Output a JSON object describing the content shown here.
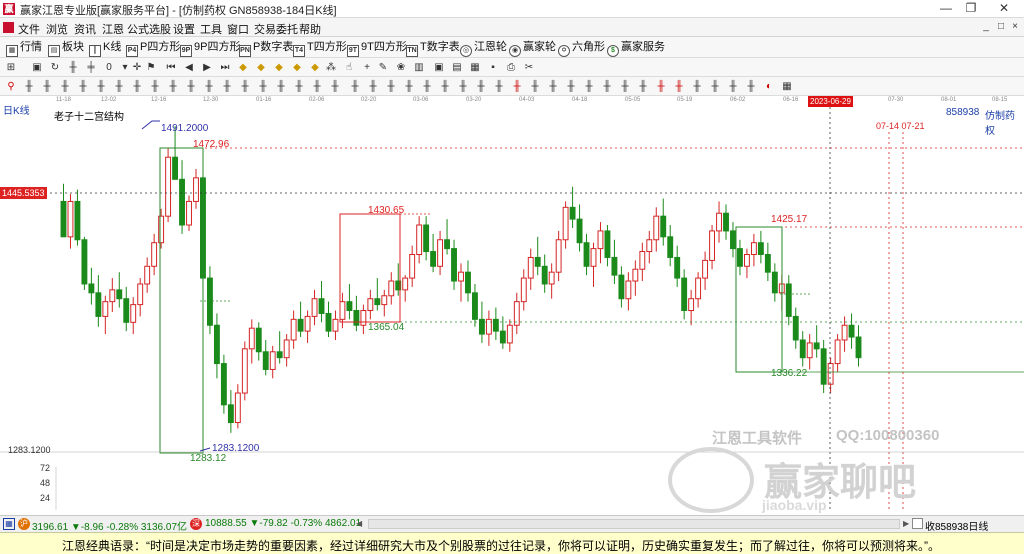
{
  "window": {
    "title": "赢家江恩专业版[赢家服务平台] - [仿制药权  GN858938-184日K线]",
    "minimize": "—",
    "restore": "❐",
    "close": "✕"
  },
  "menu": {
    "items": [
      "文件",
      "浏览",
      "资讯",
      "江恩",
      "公式选股",
      "设置",
      "工具",
      "窗口",
      "交易委托",
      "帮助"
    ],
    "mdi_min": "_",
    "mdi_restore": "□",
    "mdi_close": "×"
  },
  "toolbar1": {
    "items": [
      {
        "label": "行情",
        "icon": "grid-icon"
      },
      {
        "label": "板块",
        "icon": "sector-icon"
      },
      {
        "label": "K线",
        "icon": "kline-icon"
      },
      {
        "label": "P四方形",
        "icon": "p-square-icon",
        "glyph": "P4"
      },
      {
        "label": "9P四方形",
        "icon": "9p-square-icon",
        "glyph": "9P"
      },
      {
        "label": "P数字表",
        "icon": "p-number-table-icon",
        "glyph": "PN"
      },
      {
        "label": "T四方形",
        "icon": "t-square-icon",
        "glyph": "T4"
      },
      {
        "label": "9T四方形",
        "icon": "9t-square-icon",
        "glyph": "9T"
      },
      {
        "label": "T数字表",
        "icon": "t-number-table-icon",
        "glyph": "TN"
      },
      {
        "label": "江恩轮",
        "icon": "gann-wheel-icon"
      },
      {
        "label": "赢家轮",
        "icon": "winner-wheel-icon"
      },
      {
        "label": "六角形",
        "icon": "hexagon-icon"
      },
      {
        "label": "赢家服务",
        "icon": "service-icon"
      }
    ]
  },
  "chart_header": {
    "period_label": "日K线",
    "indicator_label": "老子十二宫结构",
    "code": "858938",
    "name": "仿制药权"
  },
  "date_axis": {
    "ticks": [
      "11-18",
      "12-02",
      "12-16",
      "12-30",
      "01-16",
      "02-06",
      "02-20",
      "03-06",
      "03-20",
      "04-03",
      "04-18",
      "05-05",
      "05-19",
      "06-02",
      "06-16",
      "07-14",
      "07-30",
      "08-01",
      "08-15"
    ],
    "current": "2023-06-29"
  },
  "price_axis": {
    "current_price": "1445.5353",
    "low_label": "1283.1200",
    "volume_ticks": [
      "72",
      "48",
      "24"
    ]
  },
  "annotations": {
    "high": "1491.2000",
    "box1_top": "1472.96",
    "box1_bottom": "1283.12",
    "low": "1283.1200",
    "box2_top": "1430.65",
    "box2_bottom": "1365.04",
    "box3_top": "1425.17",
    "box3_bottom": "1336.22",
    "future_dates": "07-14 07-21"
  },
  "chart_data": {
    "type": "candlestick",
    "title": "老子十二宫结构",
    "ylim": [
      1270,
      1500
    ],
    "up_color": "#d42424",
    "down_color": "#1a8a1a",
    "candles": [
      [
        1440,
        1452,
        1420,
        1416
      ],
      [
        1416,
        1445,
        1408,
        1440
      ],
      [
        1440,
        1448,
        1410,
        1414
      ],
      [
        1414,
        1416,
        1380,
        1384
      ],
      [
        1384,
        1395,
        1370,
        1378
      ],
      [
        1378,
        1390,
        1355,
        1362
      ],
      [
        1362,
        1376,
        1350,
        1372
      ],
      [
        1372,
        1388,
        1365,
        1380
      ],
      [
        1380,
        1392,
        1368,
        1374
      ],
      [
        1374,
        1382,
        1352,
        1358
      ],
      [
        1358,
        1375,
        1350,
        1370
      ],
      [
        1370,
        1388,
        1362,
        1384
      ],
      [
        1384,
        1402,
        1378,
        1396
      ],
      [
        1396,
        1418,
        1390,
        1412
      ],
      [
        1412,
        1435,
        1408,
        1430
      ],
      [
        1430,
        1476,
        1426,
        1470
      ],
      [
        1470,
        1491,
        1462,
        1455
      ],
      [
        1455,
        1468,
        1418,
        1424
      ],
      [
        1424,
        1444,
        1420,
        1440
      ],
      [
        1440,
        1462,
        1435,
        1456
      ],
      [
        1456,
        1460,
        1380,
        1388
      ],
      [
        1388,
        1396,
        1350,
        1356
      ],
      [
        1356,
        1364,
        1320,
        1330
      ],
      [
        1330,
        1336,
        1296,
        1302
      ],
      [
        1302,
        1312,
        1283,
        1290
      ],
      [
        1290,
        1316,
        1286,
        1310
      ],
      [
        1310,
        1345,
        1305,
        1340
      ],
      [
        1340,
        1360,
        1330,
        1354
      ],
      [
        1354,
        1358,
        1332,
        1338
      ],
      [
        1338,
        1346,
        1322,
        1326
      ],
      [
        1326,
        1342,
        1320,
        1338
      ],
      [
        1338,
        1352,
        1330,
        1334
      ],
      [
        1334,
        1350,
        1328,
        1346
      ],
      [
        1346,
        1366,
        1340,
        1360
      ],
      [
        1360,
        1372,
        1348,
        1352
      ],
      [
        1352,
        1366,
        1344,
        1362
      ],
      [
        1362,
        1380,
        1356,
        1374
      ],
      [
        1374,
        1386,
        1358,
        1364
      ],
      [
        1364,
        1372,
        1348,
        1352
      ],
      [
        1352,
        1366,
        1346,
        1360
      ],
      [
        1360,
        1378,
        1354,
        1372
      ],
      [
        1372,
        1384,
        1360,
        1366
      ],
      [
        1366,
        1376,
        1352,
        1356
      ],
      [
        1356,
        1370,
        1350,
        1366
      ],
      [
        1366,
        1380,
        1360,
        1374
      ],
      [
        1374,
        1388,
        1366,
        1370
      ],
      [
        1370,
        1380,
        1362,
        1376
      ],
      [
        1376,
        1392,
        1370,
        1386
      ],
      [
        1386,
        1398,
        1376,
        1380
      ],
      [
        1380,
        1390,
        1372,
        1388
      ],
      [
        1388,
        1410,
        1382,
        1404
      ],
      [
        1404,
        1430,
        1398,
        1424
      ],
      [
        1424,
        1430,
        1400,
        1406
      ],
      [
        1406,
        1418,
        1392,
        1396
      ],
      [
        1396,
        1420,
        1390,
        1414
      ],
      [
        1414,
        1428,
        1404,
        1408
      ],
      [
        1408,
        1414,
        1380,
        1386
      ],
      [
        1386,
        1398,
        1372,
        1392
      ],
      [
        1392,
        1400,
        1372,
        1378
      ],
      [
        1378,
        1384,
        1355,
        1360
      ],
      [
        1360,
        1372,
        1344,
        1350
      ],
      [
        1350,
        1366,
        1342,
        1360
      ],
      [
        1360,
        1368,
        1346,
        1352
      ],
      [
        1352,
        1362,
        1340,
        1344
      ],
      [
        1344,
        1360,
        1338,
        1356
      ],
      [
        1356,
        1378,
        1350,
        1372
      ],
      [
        1372,
        1394,
        1366,
        1388
      ],
      [
        1388,
        1408,
        1380,
        1402
      ],
      [
        1402,
        1416,
        1390,
        1396
      ],
      [
        1396,
        1404,
        1378,
        1384
      ],
      [
        1384,
        1398,
        1374,
        1392
      ],
      [
        1392,
        1420,
        1386,
        1414
      ],
      [
        1414,
        1440,
        1408,
        1436
      ],
      [
        1436,
        1450,
        1422,
        1428
      ],
      [
        1428,
        1438,
        1406,
        1412
      ],
      [
        1412,
        1418,
        1390,
        1396
      ],
      [
        1396,
        1412,
        1382,
        1408
      ],
      [
        1408,
        1426,
        1398,
        1420
      ],
      [
        1420,
        1424,
        1396,
        1402
      ],
      [
        1402,
        1414,
        1384,
        1390
      ],
      [
        1390,
        1396,
        1368,
        1374
      ],
      [
        1374,
        1392,
        1366,
        1386
      ],
      [
        1386,
        1400,
        1376,
        1394
      ],
      [
        1394,
        1412,
        1386,
        1406
      ],
      [
        1406,
        1420,
        1398,
        1414
      ],
      [
        1414,
        1436,
        1406,
        1430
      ],
      [
        1430,
        1442,
        1410,
        1416
      ],
      [
        1416,
        1424,
        1396,
        1402
      ],
      [
        1402,
        1410,
        1382,
        1388
      ],
      [
        1388,
        1394,
        1360,
        1366
      ],
      [
        1366,
        1380,
        1356,
        1374
      ],
      [
        1374,
        1392,
        1368,
        1388
      ],
      [
        1388,
        1406,
        1380,
        1400
      ],
      [
        1400,
        1424,
        1394,
        1420
      ],
      [
        1420,
        1440,
        1412,
        1432
      ],
      [
        1432,
        1438,
        1414,
        1420
      ],
      [
        1420,
        1426,
        1402,
        1408
      ],
      [
        1408,
        1414,
        1390,
        1396
      ],
      [
        1396,
        1408,
        1388,
        1404
      ],
      [
        1404,
        1418,
        1396,
        1412
      ],
      [
        1412,
        1420,
        1398,
        1404
      ],
      [
        1404,
        1412,
        1386,
        1392
      ],
      [
        1392,
        1398,
        1372,
        1378
      ],
      [
        1378,
        1390,
        1366,
        1384
      ],
      [
        1384,
        1390,
        1356,
        1362
      ],
      [
        1362,
        1368,
        1340,
        1346
      ],
      [
        1346,
        1352,
        1328,
        1334
      ],
      [
        1334,
        1350,
        1326,
        1344
      ],
      [
        1344,
        1356,
        1334,
        1340
      ],
      [
        1340,
        1346,
        1310,
        1316
      ],
      [
        1316,
        1334,
        1310,
        1330
      ],
      [
        1330,
        1350,
        1324,
        1346
      ],
      [
        1346,
        1362,
        1338,
        1356
      ],
      [
        1356,
        1364,
        1340,
        1348
      ],
      [
        1348,
        1356,
        1328,
        1334
      ]
    ]
  },
  "status": {
    "sh_index": "3196.61 ▼-8.96 -0.28% 3136.07亿",
    "sz_index": "10888.55 ▼-79.82 -0.73% 4862.01",
    "right": "收858938日线"
  },
  "quote": "江恩经典语录：“时间是决定市场走势的重要因素，经过详细研究大市及个别股票的过往记录，你将可以证明，历史确实重复发生；而了解过往，你将可以预测将来。”。",
  "watermarks": {
    "software": "江恩工具软件",
    "qq": "QQ:100800360",
    "forum": "赢家聊吧",
    "url": "jiaoba.vip"
  }
}
